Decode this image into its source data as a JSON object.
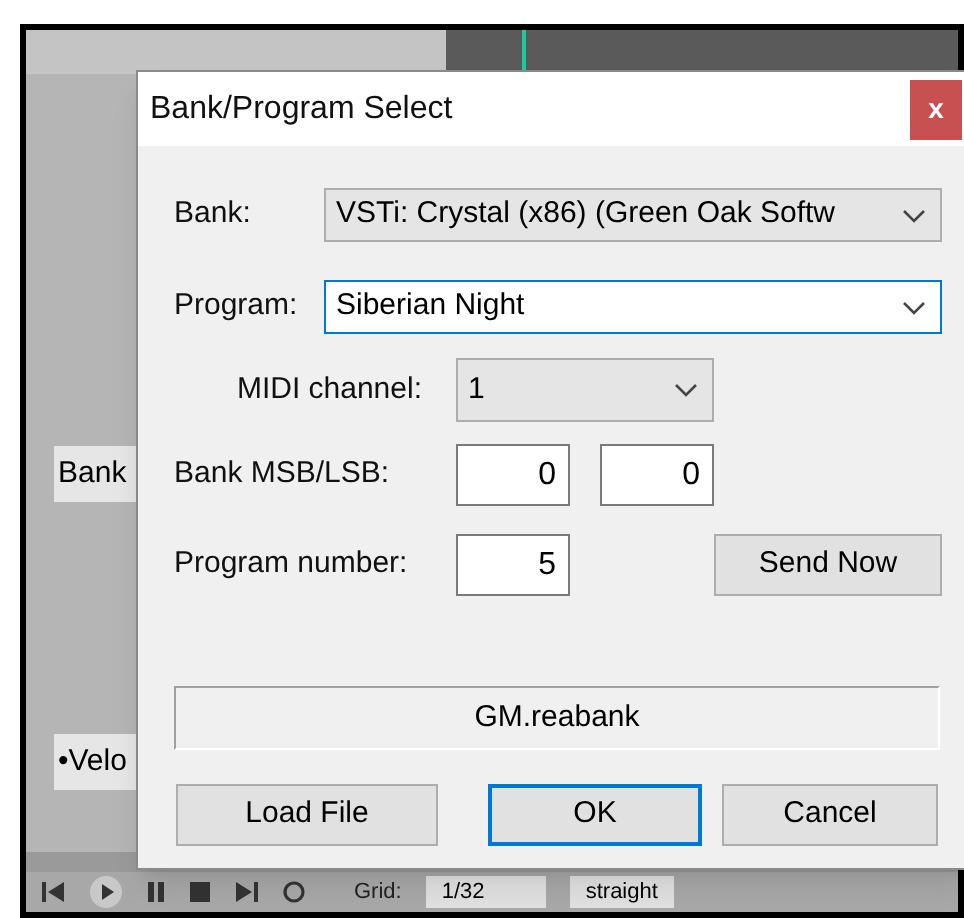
{
  "background": {
    "side_buttons": [
      "Bank",
      "•Velo"
    ],
    "toolbar": {
      "grid_label": "Grid:",
      "grid_value": "1/32",
      "swing": "straight"
    }
  },
  "dialog": {
    "title": "Bank/Program Select",
    "close": "x",
    "bank": {
      "label": "Bank:",
      "value": "VSTi: Crystal (x86) (Green Oak Softw"
    },
    "program": {
      "label": "Program:",
      "value": "Siberian Night",
      "focused": true
    },
    "midi_channel": {
      "label": "MIDI channel:",
      "value": "1"
    },
    "bank_msb_lsb": {
      "label": "Bank MSB/LSB:",
      "msb": "0",
      "lsb": "0"
    },
    "program_number": {
      "label": "Program number:",
      "value": "5"
    },
    "send_button": "Send Now",
    "file": "GM.reabank",
    "buttons": [
      {
        "label": "Load File",
        "default": false
      },
      {
        "label": "OK",
        "default": true
      },
      {
        "label": "Cancel",
        "default": false
      }
    ]
  }
}
